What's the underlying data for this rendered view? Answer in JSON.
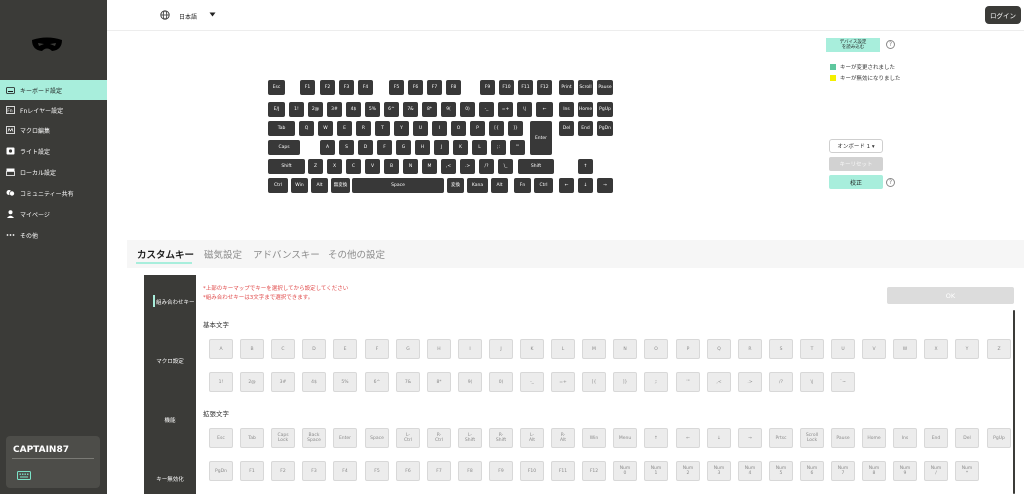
{
  "sidebar": {
    "logo": "mask-logo",
    "items": [
      {
        "label": "キーボード設定",
        "icon": "keyboard-icon",
        "active": true
      },
      {
        "label": "Fnレイヤー設定",
        "icon": "fn-icon",
        "active": false
      },
      {
        "label": "マクロ編集",
        "icon": "macro-icon",
        "active": false
      },
      {
        "label": "ライト設定",
        "icon": "light-icon",
        "active": false
      },
      {
        "label": "ローカル設定",
        "icon": "local-icon",
        "active": false
      },
      {
        "label": "コミュニティー共有",
        "icon": "community-icon",
        "active": false
      },
      {
        "label": "マイページ",
        "icon": "user-icon",
        "active": false
      },
      {
        "label": "その他",
        "icon": "more-icon",
        "active": false
      }
    ],
    "device_name": "CAPTAIN87"
  },
  "top_bar": {
    "language_icon": "globe-icon",
    "language": "日本語",
    "dropdown_icon": "caret-down-icon",
    "login": "ログイン"
  },
  "actions": {
    "device_settings": "デバイス設定\nを読み込む",
    "help_icon": "?"
  },
  "legend": [
    {
      "label": "キーが変更されました",
      "color": "#5ec79e"
    },
    {
      "label": "キーが無効になりました",
      "color": "#f4f000"
    }
  ],
  "right_panel": {
    "onboard": "オンボード 1 ▾",
    "key_reset": "キーリセット",
    "calibrate": "校正",
    "help_icon": "?"
  },
  "keyboard": {
    "rows": [
      [
        "Esc",
        "F1",
        "F2",
        "F3",
        "F4",
        "F5",
        "F6",
        "F7",
        "F8",
        "F9",
        "F10",
        "F11",
        "F12",
        "Print",
        "Scroll",
        "Pause"
      ],
      [
        "E/J",
        "1!",
        "2@",
        "3#",
        "4$",
        "5%",
        "6^",
        "7&",
        "8*",
        "9(",
        "0)",
        "-_",
        "=+",
        "\\|",
        "←",
        "Ins",
        "Home",
        "PgUp"
      ],
      [
        "Tab",
        "Q",
        "W",
        "E",
        "R",
        "T",
        "Y",
        "U",
        "I",
        "O",
        "P",
        "[{",
        "]}",
        "Enter",
        "Del",
        "End",
        "PgDn"
      ],
      [
        "Caps",
        "A",
        "S",
        "D",
        "F",
        "G",
        "H",
        "J",
        "K",
        "L",
        ";:",
        "'\"",
        "|}"
      ],
      [
        "Shift",
        "Z",
        "X",
        "C",
        "V",
        "B",
        "N",
        "M",
        ",<",
        ".>",
        "/?",
        "\\_",
        "Shift",
        "↑"
      ],
      [
        "Ctrl",
        "Win",
        "Alt",
        "無変換",
        "Space",
        "変換",
        "Kana",
        "Alt",
        "Fn",
        "Ctrl",
        "←",
        "↓",
        "→"
      ]
    ]
  },
  "tabs": [
    "カスタムキー",
    "磁気設定",
    "アドバンスキー",
    "その他の設定"
  ],
  "editor": {
    "side_tabs": [
      "組み合わせキー",
      "マクロ設定",
      "機能",
      "キー無効化"
    ],
    "notes": [
      "*上部のキーマップでキーを選択してから設定してください",
      "*組み合わせキーは3文字まで選択できます。"
    ],
    "ok": "OK",
    "basic": {
      "title": "基本文字",
      "keys": [
        "A",
        "B",
        "C",
        "D",
        "E",
        "F",
        "G",
        "H",
        "I",
        "J",
        "K",
        "L",
        "M",
        "N",
        "O",
        "P",
        "Q",
        "R",
        "S",
        "T",
        "U",
        "V",
        "W",
        "X",
        "Y",
        "Z",
        "1!",
        "2@",
        "3#",
        "4$",
        "5%",
        "6^",
        "7&",
        "8*",
        "9(",
        "0)",
        "-_",
        "=+",
        "[{",
        "]}",
        ";:",
        "'\"",
        ",<",
        ".>",
        "/?",
        "\\|",
        "`~"
      ]
    },
    "extended": {
      "title": "拡張文字",
      "keys": [
        "Esc",
        "Tab",
        "Caps\nLock",
        "Back\nSpace",
        "Enter",
        "Space",
        "L-\nCtrl",
        "R-\nCtrl",
        "L-\nShift",
        "R-\nShift",
        "L-\nAlt",
        "R-\nAlt",
        "Win",
        "Menu",
        "↑",
        "←",
        "↓",
        "→",
        "Prtsc",
        "Scroll\nLock",
        "Pause",
        "Home",
        "Ins",
        "End",
        "Del",
        "PgUp",
        "PgDn",
        "F1",
        "F2",
        "F3",
        "F4",
        "F5",
        "F6",
        "F7",
        "F8",
        "F9",
        "F10",
        "F11",
        "F12",
        "Num\n0",
        "Num\n1",
        "Num\n2",
        "Num\n3",
        "Num\n4",
        "Num\n5",
        "Num\n6",
        "Num\n7",
        "Num\n8",
        "Num\n9",
        "Num\n/",
        "Num\n*"
      ]
    }
  }
}
